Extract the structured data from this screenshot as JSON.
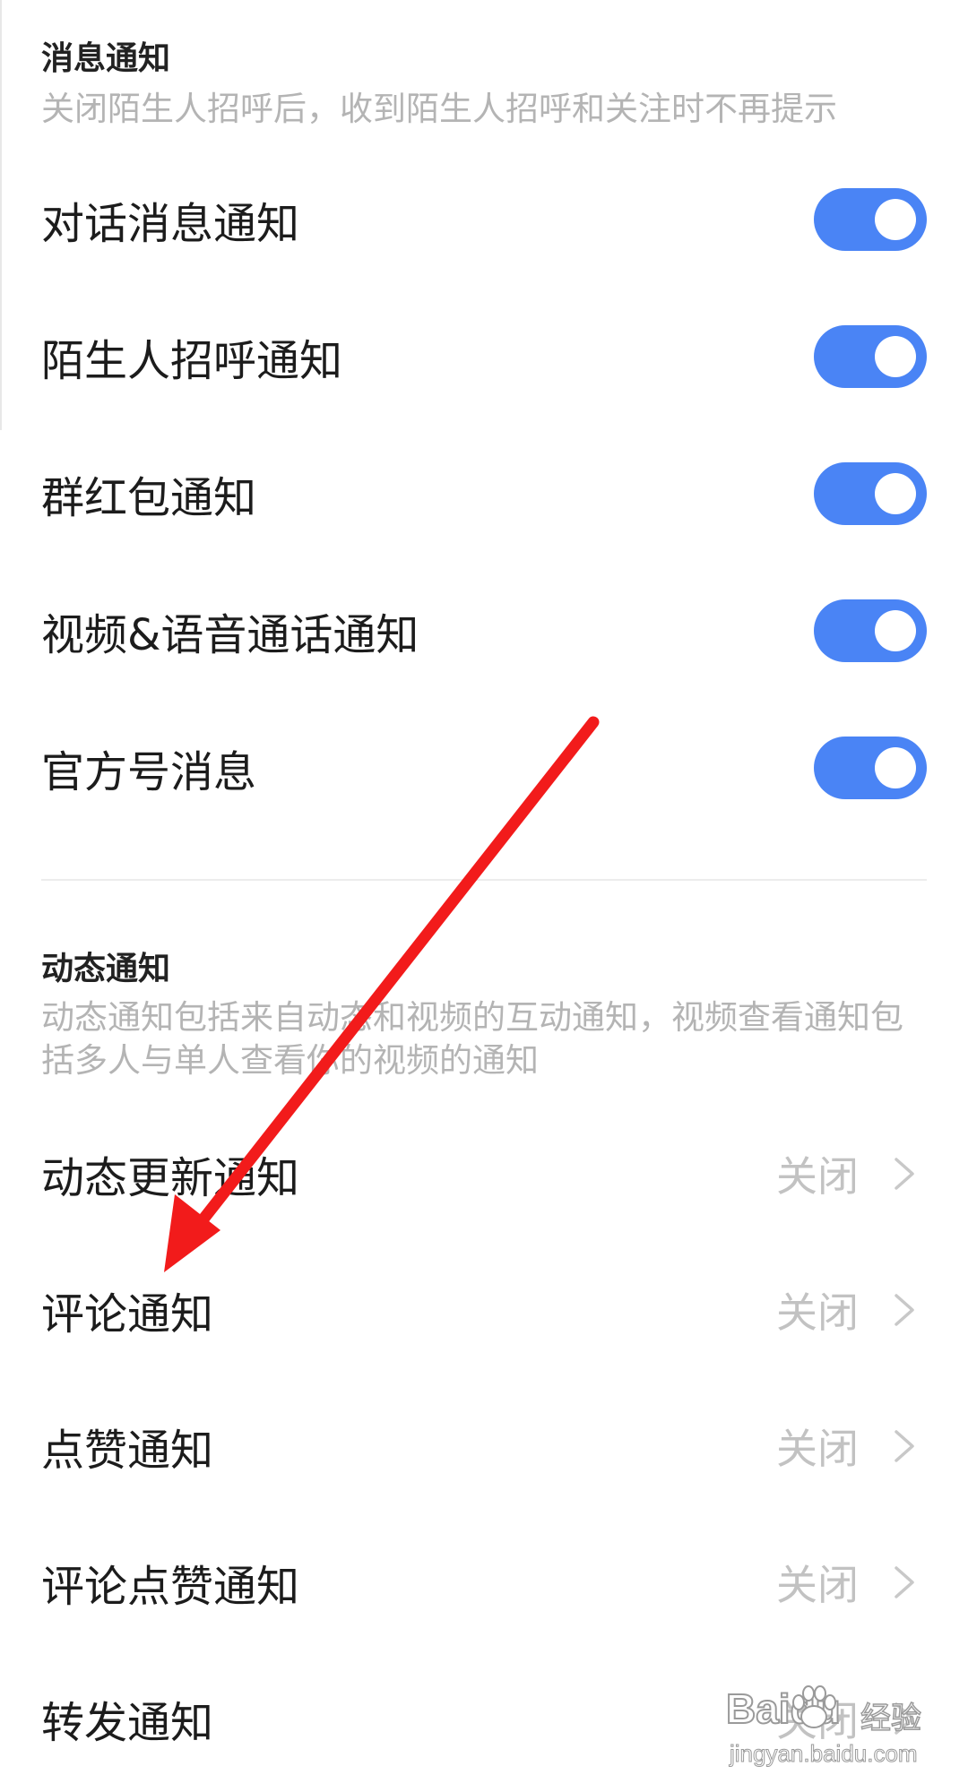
{
  "message_section": {
    "title": "消息通知",
    "description": "关闭陌生人招呼后，收到陌生人招呼和关注时不再提示",
    "rows": [
      {
        "label": "对话消息通知",
        "enabled": true
      },
      {
        "label": "陌生人招呼通知",
        "enabled": true
      },
      {
        "label": "群红包通知",
        "enabled": true
      },
      {
        "label": "视频&语音通话通知",
        "enabled": true
      },
      {
        "label": "官方号消息",
        "enabled": true
      }
    ]
  },
  "activity_section": {
    "title": "动态通知",
    "description": "动态通知包括来自动态和视频的互动通知，视频查看通知包括多人与单人查看你的视频的通知",
    "rows": [
      {
        "label": "动态更新通知",
        "value": "关闭"
      },
      {
        "label": "评论通知",
        "value": "关闭"
      },
      {
        "label": "点赞通知",
        "value": "关闭"
      },
      {
        "label": "评论点赞通知",
        "value": "关闭"
      },
      {
        "label": "转发通知",
        "value": "关闭"
      }
    ]
  },
  "colors": {
    "toggle_on": "#4a84f5",
    "annotation_arrow": "#f21b1b"
  },
  "watermark": {
    "brand": "Baidu",
    "sub": "经验",
    "url": "jingyan.baidu.com"
  }
}
